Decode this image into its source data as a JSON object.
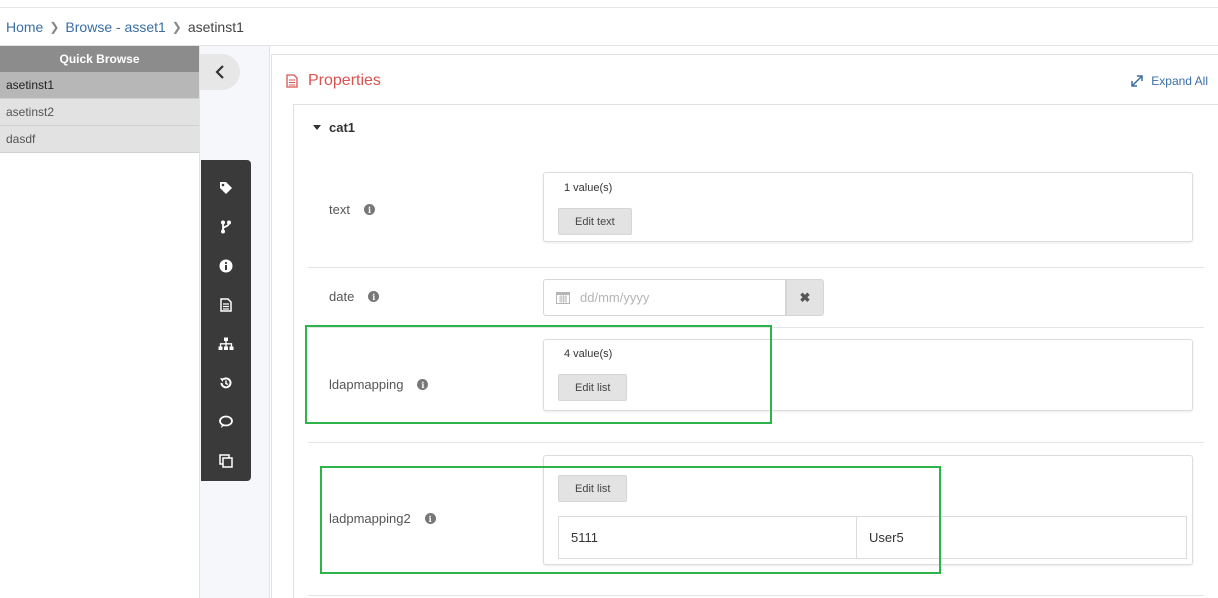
{
  "breadcrumb": {
    "home": "Home",
    "browse": "Browse - asset1",
    "current": "asetinst1"
  },
  "quick_browse": {
    "title": "Quick Browse",
    "items": [
      {
        "label": "asetinst1",
        "active": true
      },
      {
        "label": "asetinst2",
        "active": false
      },
      {
        "label": "dasdf",
        "active": false
      }
    ]
  },
  "toolbar_icons": [
    "tag-icon",
    "branch-icon",
    "info-icon",
    "document-icon",
    "hierarchy-icon",
    "history-icon",
    "comments-icon",
    "copy-icon"
  ],
  "properties": {
    "title": "Properties",
    "expand_all": "Expand All",
    "category": "cat1",
    "rows": {
      "text": {
        "label": "text",
        "count": "1 value(s)",
        "button": "Edit text"
      },
      "date": {
        "label": "date",
        "placeholder": "dd/mm/yyyy"
      },
      "ldapmapping": {
        "label": "ldapmapping",
        "count": "4 value(s)",
        "button": "Edit list"
      },
      "ladpmapping2": {
        "label": "ladpmapping2",
        "button": "Edit list",
        "key": "5111",
        "value": "User5"
      }
    }
  },
  "colors": {
    "accent": "#d9534f",
    "link": "#3a6ea5",
    "highlight": "#2db34a",
    "toolbar": "#3a3a3a"
  }
}
